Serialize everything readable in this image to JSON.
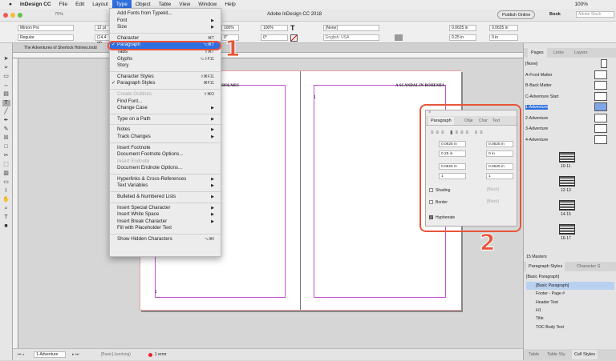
{
  "menubar": {
    "apple": "",
    "app": "InDesign CC",
    "items": [
      "File",
      "Edit",
      "Layout",
      "Type",
      "Object",
      "Table",
      "View",
      "Window",
      "Help"
    ],
    "status_battery": "100%"
  },
  "titlebar": {
    "zoom": "75%",
    "title": "Adobe InDesign CC 2018",
    "publish": "Publish Online",
    "workspace": "Book",
    "search_placeholder": "Adobe Stock"
  },
  "control": {
    "font": "Minion Pro",
    "style": "Regular",
    "size": "12 pt",
    "leading": "(14.4 pt)",
    "hscale": "100%",
    "vscale": "100%",
    "tracking": "0\"",
    "skew": "0°",
    "char_style": "[None]",
    "language": "English: USA",
    "left_indent": "0.0625 in",
    "right_indent": "0.0625 in",
    "first_indent": "0.25 in",
    "last_indent": "0 in"
  },
  "document": {
    "tab": "The Adventures of Sherlock Holmes.indd",
    "left_header": "K HOLMES",
    "right_header": "A SCANDAL IN BOHEMIA",
    "left_page_num": "1",
    "right_page_num": "1"
  },
  "type_menu": {
    "items": [
      {
        "label": "Add Fonts from Typekit..."
      },
      {
        "label": "Font",
        "sub": true
      },
      {
        "label": "Size",
        "sub": true
      },
      {
        "sep": true
      },
      {
        "label": "Character",
        "sc": "⌘T"
      },
      {
        "label": "Paragraph",
        "sc": "⌥⌘T",
        "checked": true,
        "hl": true
      },
      {
        "label": "Tabs",
        "sc": "⇧⌘T"
      },
      {
        "label": "Glyphs",
        "sc": "⌥⇧F11"
      },
      {
        "label": "Story"
      },
      {
        "sep": true
      },
      {
        "label": "Character Styles",
        "sc": "⇧⌘F11"
      },
      {
        "label": "Paragraph Styles",
        "sc": "⌘F11",
        "checked": true
      },
      {
        "sep": true
      },
      {
        "label": "Create Outlines",
        "sc": "⇧⌘O",
        "dis": true
      },
      {
        "label": "Find Font..."
      },
      {
        "label": "Change Case",
        "sub": true
      },
      {
        "sep": true
      },
      {
        "label": "Type on a Path",
        "sub": true
      },
      {
        "sep": true
      },
      {
        "label": "Notes",
        "sub": true
      },
      {
        "label": "Track Changes",
        "sub": true
      },
      {
        "sep": true
      },
      {
        "label": "Insert Footnote"
      },
      {
        "label": "Document Footnote Options..."
      },
      {
        "label": "Insert Endnote",
        "dis": true
      },
      {
        "label": "Document Endnote Options..."
      },
      {
        "sep": true
      },
      {
        "label": "Hyperlinks & Cross-References",
        "sub": true
      },
      {
        "label": "Text Variables",
        "sub": true
      },
      {
        "sep": true
      },
      {
        "label": "Bulleted & Numbered Lists",
        "sub": true
      },
      {
        "sep": true
      },
      {
        "label": "Insert Special Character",
        "sub": true
      },
      {
        "label": "Insert White Space",
        "sub": true
      },
      {
        "label": "Insert Break Character",
        "sub": true
      },
      {
        "label": "Fill with Placeholder Text"
      },
      {
        "sep": true
      },
      {
        "label": "Show Hidden Characters",
        "sc": "⌥⌘I"
      }
    ]
  },
  "annotations": {
    "one": "1",
    "two": "2"
  },
  "paragraph_panel": {
    "tabs": [
      "Paragraph",
      "Obje",
      "Char",
      "Text"
    ],
    "left_indent": "0.0625 in",
    "right_indent": "0.0625 in",
    "first_indent": "0.25 in",
    "last_indent": "0 in",
    "space_before": "0.0625 in",
    "space_after": "0.0625 in",
    "drop_lines": "1",
    "drop_chars": "1",
    "shading": "Shading",
    "border": "Border",
    "swatch": "[Black]",
    "hyphenate": "Hyphenate"
  },
  "pages_panel": {
    "tabs": [
      "Pages",
      "Links",
      "Layers"
    ],
    "masters": [
      "[None]",
      "A-Front Matter",
      "B-Back Matter",
      "C-Adventure Start",
      "1-Adventure",
      "2-Adventure",
      "3-Adventure",
      "4-Adventure"
    ],
    "spreads": [
      "10-11",
      "12-13",
      "14-15",
      "16-17"
    ],
    "count": "15 Masters"
  },
  "styles_panel": {
    "tabs": [
      "Paragraph Styles",
      "Character S"
    ],
    "current": "[Basic Paragraph]",
    "items": [
      "[Basic Paragraph]",
      "Footer - Page #",
      "Header Text",
      "H1",
      "Title",
      "TOC Body Text"
    ]
  },
  "bottom_tabs": [
    "Table",
    "Table Sty",
    "Cell Styles"
  ],
  "status": {
    "page": "1-Adventure",
    "preflight_profile": "[Basic] (working)",
    "errors": "1 error"
  },
  "colors": {
    "accent": "#2f6fdf",
    "annotation": "#e8553a",
    "margin": "#c64fd6"
  }
}
